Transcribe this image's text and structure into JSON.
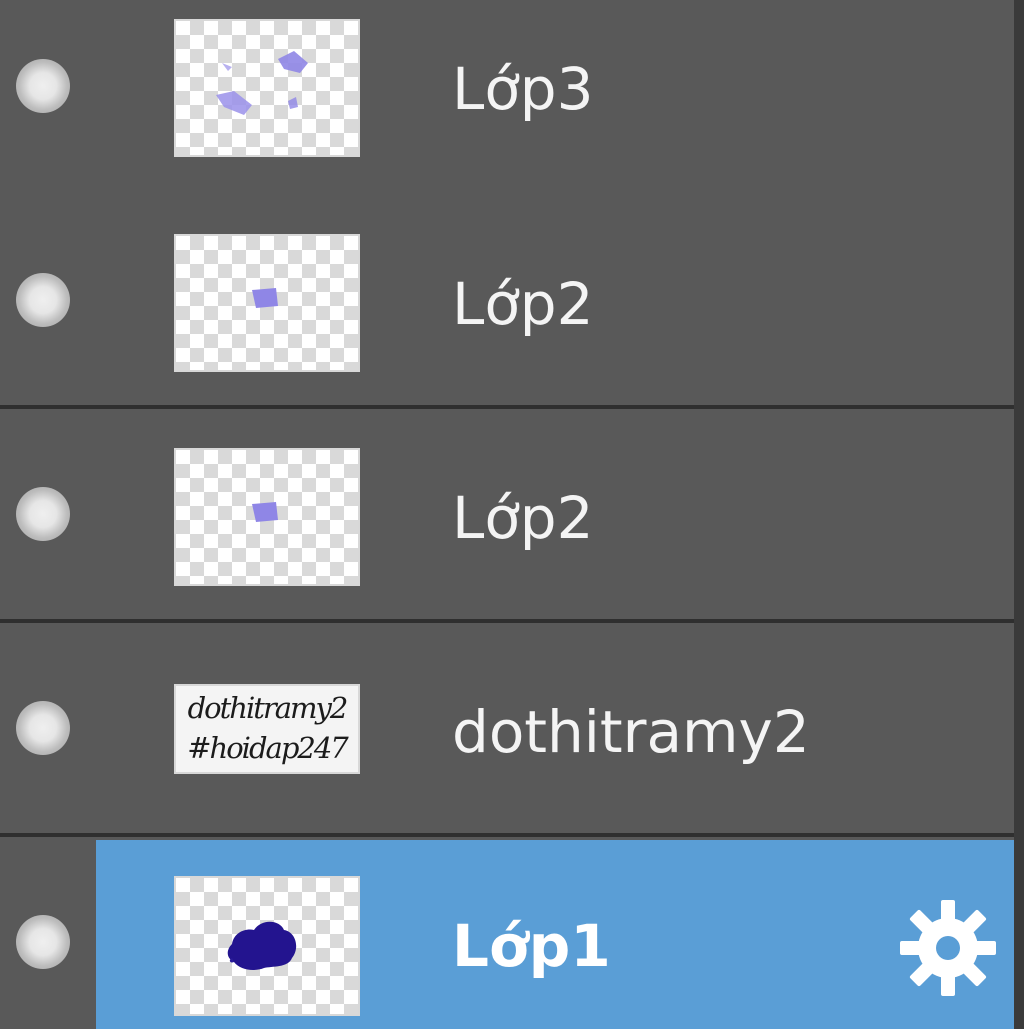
{
  "layers_panel": {
    "layers": [
      {
        "name": "Lớp3",
        "selected": false,
        "thumbnail": "purple-scribbles"
      },
      {
        "name": "Lớp2",
        "selected": false,
        "thumbnail": "purple-dot"
      },
      {
        "name": "Lớp2",
        "selected": false,
        "thumbnail": "purple-dot"
      },
      {
        "name": "dothitramy2",
        "selected": false,
        "thumbnail": "text-preview",
        "thumbnail_text": [
          "dothitramy2",
          "#hoidap247"
        ]
      },
      {
        "name": "Lớp1",
        "selected": true,
        "thumbnail": "dark-blue-blob"
      }
    ],
    "selected_icon": "gear-icon",
    "visibility_icon": "visibility-dot-icon"
  },
  "colors": {
    "panel_bg": "#595959",
    "selected_bg": "#5a9ed6",
    "divider": "#2f2f2f",
    "text": "#f4f4f4",
    "thumb_accent_light": "#8f86e6",
    "thumb_accent_dark": "#23148f"
  }
}
